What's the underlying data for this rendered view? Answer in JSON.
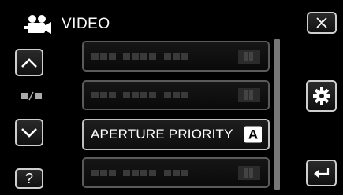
{
  "header": {
    "icon": "video-camera-icon",
    "title": "VIDEO"
  },
  "nav": {
    "up_icon": "chevron-up-icon",
    "down_icon": "chevron-down-icon",
    "page_indicator_icon": "page-indicator-icon",
    "help_label": "?"
  },
  "menu": {
    "items": [
      {
        "label": "",
        "state": "blurred",
        "blurred": true
      },
      {
        "label": "",
        "state": "blurred",
        "blurred": true
      },
      {
        "label": "APERTURE PRIORITY",
        "badge": "A",
        "state": "active"
      },
      {
        "label": "",
        "state": "blurred",
        "blurred": true
      }
    ]
  },
  "side": {
    "close_icon": "close-icon",
    "gear_icon": "gear-icon",
    "back_icon": "return-icon"
  },
  "colors": {
    "background": "#000000",
    "text": "#ffffff",
    "border": "#cfcfcf",
    "scrollbar": "#777777"
  }
}
